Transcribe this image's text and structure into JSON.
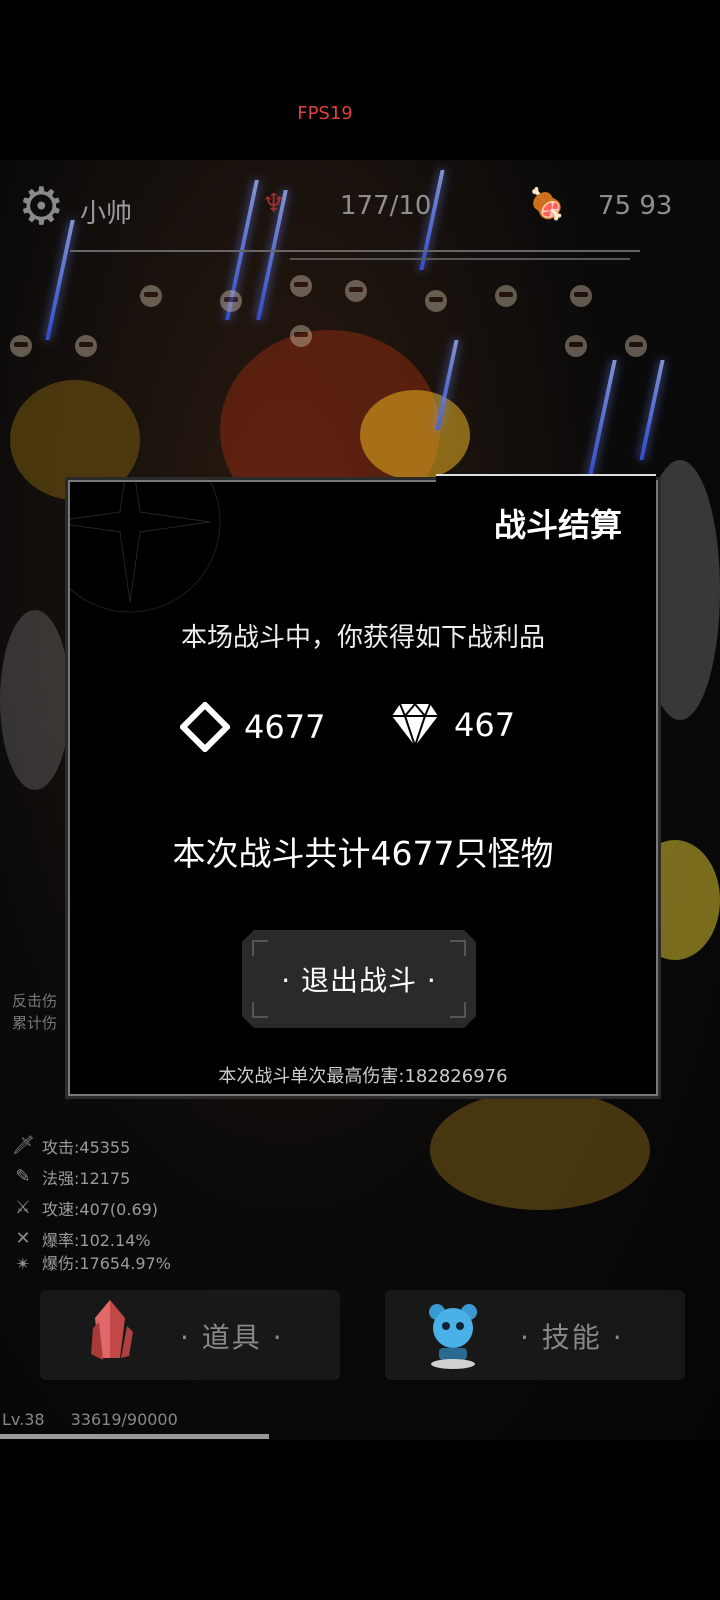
{
  "fps_label": "FPS19",
  "hud": {
    "settings_icon": "gear-icon",
    "player_name": "小帅",
    "wave_icon": "demon-icon",
    "wave_count": "177/10",
    "food_icon": "meat-icon",
    "food_count": "75 93"
  },
  "stats": [
    {
      "icon": "sword-icon",
      "text": "攻击:45355"
    },
    {
      "icon": "wand-icon",
      "text": "法强:12175"
    },
    {
      "icon": "speed-icon",
      "text": "攻速:407(0.69)"
    },
    {
      "icon": "crit-icon",
      "text": "爆率:102.14%"
    },
    {
      "icon": "crit-dmg-icon",
      "text": "爆伤:17654.97%"
    }
  ],
  "side_left": {
    "line1": "反击伤",
    "line2": "累计伤"
  },
  "bottom": {
    "items_label": "· 道具 ·",
    "skills_label": "· 技能 ·"
  },
  "level": {
    "label": "Lv.38",
    "xp": "33619/90000",
    "progress": 0.3735
  },
  "dialog": {
    "title": "战斗结算",
    "loot_message": "本场战斗中，你获得如下战利品",
    "reward_crystal": "4677",
    "reward_diamond": "467",
    "monster_message": "本次战斗共计4677只怪物",
    "exit_label": "· 退出战斗 ·",
    "max_damage": "本次战斗单次最高伤害:182826976"
  },
  "colors": {
    "fps": "#e04040",
    "dialog_bg": "#000000",
    "accent_gray": "#777777"
  }
}
